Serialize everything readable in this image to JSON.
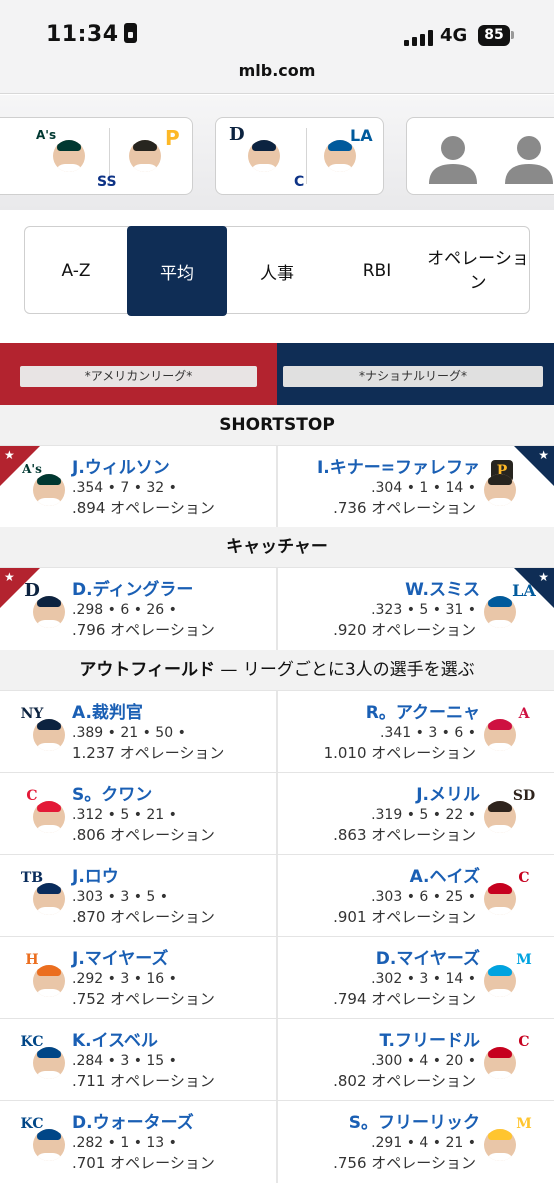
{
  "status_bar": {
    "time": "11:34",
    "network": "4G",
    "battery": "85"
  },
  "browser": {
    "url": "mlb.com"
  },
  "matchups": [
    {
      "position": "SS"
    },
    {
      "position": "C"
    }
  ],
  "sort_tabs": [
    {
      "label": "A-Z",
      "active": false
    },
    {
      "label": "平均",
      "active": true
    },
    {
      "label": "人事",
      "active": false
    },
    {
      "label": "RBI",
      "active": false
    },
    {
      "label": "オペレーション",
      "active": false
    }
  ],
  "leagues": {
    "al": "*アメリカンリーグ*",
    "nl": "*ナショナルリーグ*"
  },
  "sections": [
    {
      "title": "SHORTSTOP",
      "rows": [
        {
          "left": {
            "name": "J.ウィルソン",
            "line1": ".354 • 7 • 32 •",
            "line2": ".894 オペレーション",
            "team": "A's",
            "team_color": "#003831"
          },
          "right": {
            "name": "I.キナー=ファレファ",
            "line1": ".304 • 1 • 14 •",
            "line2": ".736 オペレーション",
            "team": "P",
            "team_color": "#27251f"
          }
        }
      ]
    },
    {
      "title": "キャッチャー",
      "rows": [
        {
          "left": {
            "name": "D.ディングラー",
            "line1": ".298 • 6 • 26 •",
            "line2": ".796 オペレーション",
            "team": "D",
            "team_color": "#0c2340"
          },
          "right": {
            "name": "W.スミス",
            "line1": ".323 • 5 • 31 •",
            "line2": ".920 オペレーション",
            "team": "LA",
            "team_color": "#005a9c"
          }
        }
      ]
    },
    {
      "title": "アウトフィールド",
      "note": " — リーグごとに3人の選手を選ぶ",
      "rows": [
        {
          "left": {
            "name": "A.裁判官",
            "line1": ".389 • 21 • 50 •",
            "line2": "1.237 オペレーション",
            "team": "NY",
            "team_color": "#0c2340"
          },
          "right": {
            "name": "R。アクーニャ",
            "line1": ".341 • 3 • 6 •",
            "line2": "1.010 オペレーション",
            "team": "A",
            "team_color": "#ce1141"
          }
        },
        {
          "left": {
            "name": "S。クワン",
            "line1": ".312 • 5 • 21 •",
            "line2": ".806 オペレーション",
            "team": "C",
            "team_color": "#e31937"
          },
          "right": {
            "name": "J.メリル",
            "line1": ".319 • 5 • 22 •",
            "line2": ".863 オペレーション",
            "team": "SD",
            "team_color": "#2f241d"
          }
        },
        {
          "left": {
            "name": "J.ロウ",
            "line1": ".303 • 3 • 5 •",
            "line2": ".870 オペレーション",
            "team": "TB",
            "team_color": "#092c5c"
          },
          "right": {
            "name": "A.ヘイズ",
            "line1": ".303 • 6 • 25 •",
            "line2": ".901 オペレーション",
            "team": "C",
            "team_color": "#c6011f"
          }
        },
        {
          "left": {
            "name": "J.マイヤーズ",
            "line1": ".292 • 3 • 16 •",
            "line2": ".752 オペレーション",
            "team": "H",
            "team_color": "#eb6e1f"
          },
          "right": {
            "name": "D.マイヤーズ",
            "line1": ".302 • 3 • 14 •",
            "line2": ".794 オペレーション",
            "team": "M",
            "team_color": "#00a3e0"
          }
        },
        {
          "left": {
            "name": "K.イスベル",
            "line1": ".284 • 3 • 15 •",
            "line2": ".711 オペレーション",
            "team": "KC",
            "team_color": "#004687"
          },
          "right": {
            "name": "T.フリードル",
            "line1": ".300 • 4 • 20 •",
            "line2": ".802 オペレーション",
            "team": "C",
            "team_color": "#c6011f"
          }
        },
        {
          "left": {
            "name": "D.ウォーターズ",
            "line1": ".282 • 1 • 13 •",
            "line2": ".701 オペレーション",
            "team": "KC",
            "team_color": "#004687"
          },
          "right": {
            "name": "S。フリーリック",
            "line1": ".291 • 4 • 21 •",
            "line2": ".756 オペレーション",
            "team": "M",
            "team_color": "#ffc52f"
          }
        }
      ]
    }
  ]
}
